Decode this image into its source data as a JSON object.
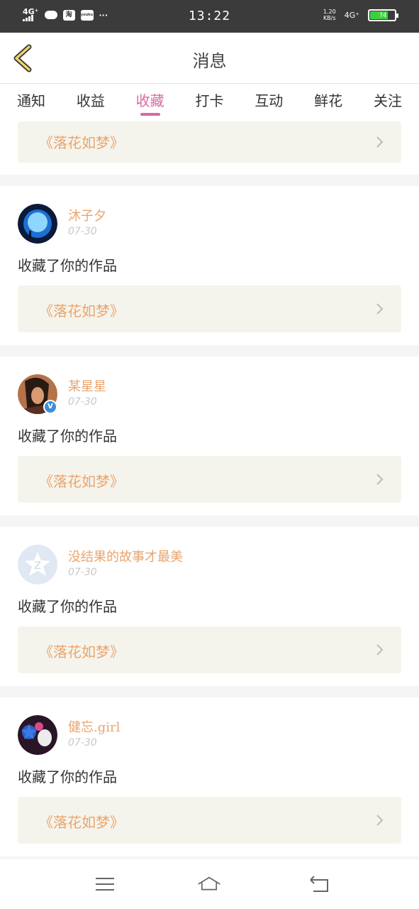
{
  "status_bar": {
    "network_left": "4G⁺",
    "app_icon_1": "淘",
    "app_icon_2": "youku",
    "more": "···",
    "time": "13:22",
    "speed": "1.20",
    "speed_unit": "KB/s",
    "network_right": "4G⁺",
    "battery_level": "74"
  },
  "header": {
    "title": "消息",
    "back_icon": "chevron-left-icon"
  },
  "tabs": [
    {
      "label": "通知",
      "active": false
    },
    {
      "label": "收益",
      "active": false
    },
    {
      "label": "收藏",
      "active": true
    },
    {
      "label": "打卡",
      "active": false
    },
    {
      "label": "互动",
      "active": false
    },
    {
      "label": "鲜花",
      "active": false
    },
    {
      "label": "关注",
      "active": false
    }
  ],
  "top_partial": {
    "work_title": "《落花如梦》"
  },
  "notifications": [
    {
      "username": "沐子夕",
      "date": "07-30",
      "action": "收藏了你的作品",
      "work_title": "《落花如梦》",
      "verified": false
    },
    {
      "username": "某星星",
      "date": "07-30",
      "action": "收藏了你的作品",
      "work_title": "《落花如梦》",
      "verified": true
    },
    {
      "username": "没结果的故事才最美",
      "date": "07-30",
      "action": "收藏了你的作品",
      "work_title": "《落花如梦》",
      "verified": false
    },
    {
      "username": "健忘.girl",
      "date": "07-30",
      "action": "收藏了你的作品",
      "work_title": "《落花如梦》",
      "verified": false
    }
  ],
  "navbar": {
    "menu_icon": "menu-icon",
    "home_icon": "home-icon",
    "back_icon": "return-icon"
  },
  "colors": {
    "accent": "#d76aa3",
    "username": "#e9a56e",
    "work_box_bg": "#f5f4ec"
  }
}
